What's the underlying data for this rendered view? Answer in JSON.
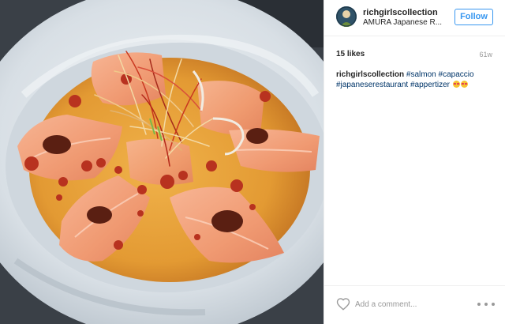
{
  "post": {
    "photo": {
      "subject": "salmon carpaccio plate",
      "palette": {
        "plate": "#dfe5ea",
        "sauce": "#e8a23a",
        "salmon": "#f2a07a",
        "chili": "#b8321f"
      }
    },
    "header": {
      "username": "richgirlscollection",
      "location": "AMURA Japanese R...",
      "follow_label": "Follow"
    },
    "stats": {
      "likes": "15 likes",
      "age": "61w"
    },
    "caption": {
      "username": "richgirlscollection",
      "hashtags": [
        "#salmon",
        "#capaccio",
        "#japaneserestaurant",
        "#appertizer"
      ],
      "emojis": [
        "heart-eyes",
        "heart-eyes"
      ]
    },
    "footer": {
      "comment_placeholder": "Add a comment...",
      "like_icon": "heart-outline-icon",
      "more_icon": "more-options-icon"
    },
    "colors": {
      "accent": "#3897f0",
      "hashtag": "#003569",
      "muted": "#999999",
      "text": "#262626",
      "divider": "#efefef"
    }
  }
}
